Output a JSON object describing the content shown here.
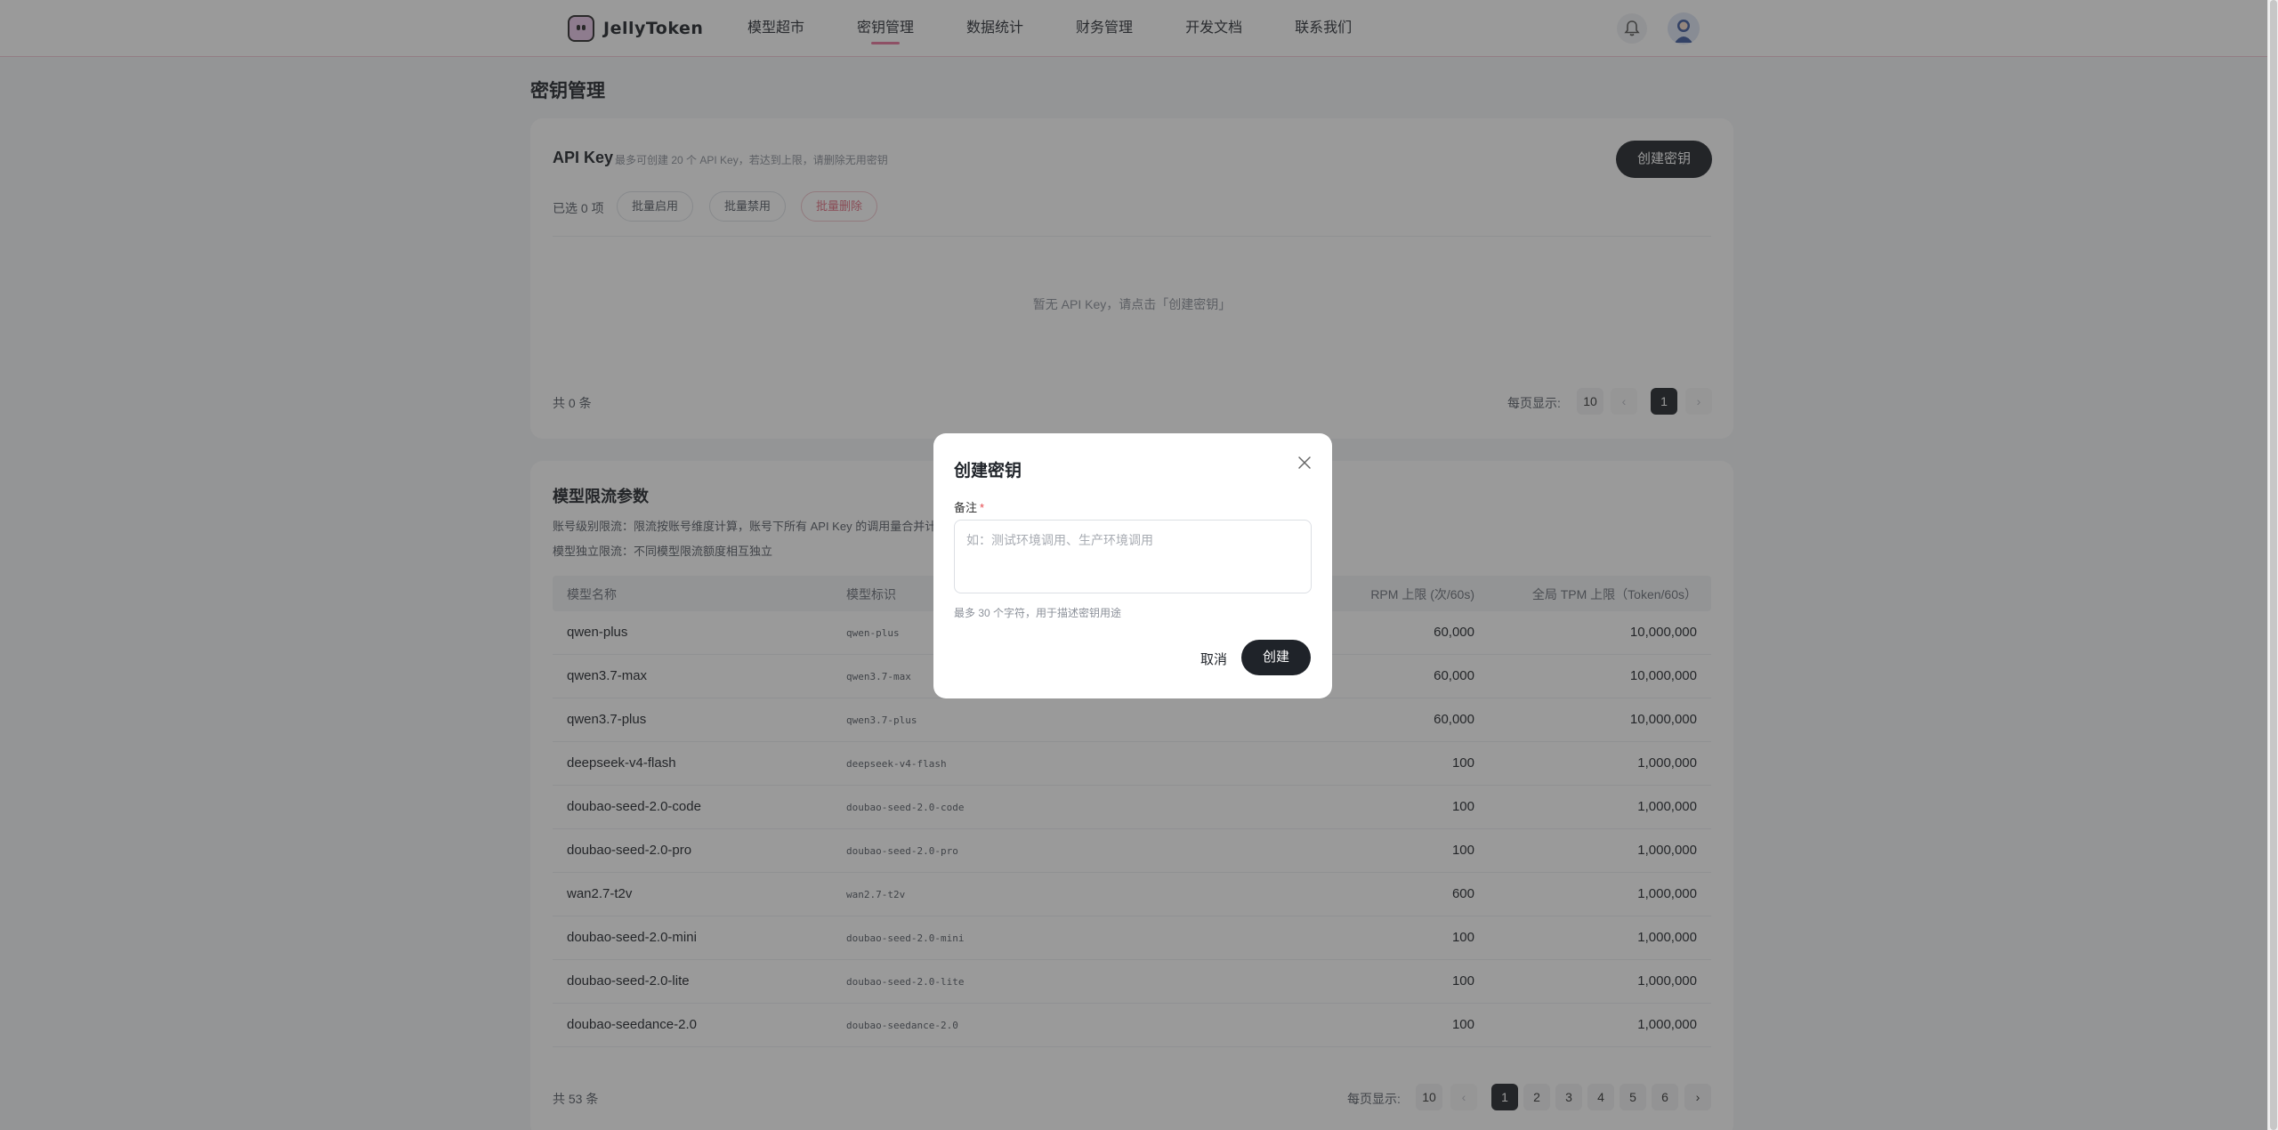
{
  "brand": {
    "name": "JellyToken"
  },
  "nav": [
    {
      "label": "模型超市"
    },
    {
      "label": "密钥管理",
      "active": true
    },
    {
      "label": "数据统计"
    },
    {
      "label": "财务管理"
    },
    {
      "label": "开发文档"
    },
    {
      "label": "联系我们"
    }
  ],
  "page": {
    "title": "密钥管理"
  },
  "api_key": {
    "title": "API Key",
    "subtitle": "最多可创建 20 个 API Key，若达到上限，请删除无用密钥",
    "create_label": "创建密钥",
    "selected": "已选 0 项",
    "batch_enable": "批量启用",
    "batch_disable": "批量禁用",
    "batch_delete": "批量删除",
    "empty": "暂无 API Key，请点击「创建密钥」",
    "total": "共 0 条",
    "per_page_label": "每页显示:",
    "per_page": "10",
    "prev": "‹",
    "next": "›",
    "current_page": "1"
  },
  "limits": {
    "title": "模型限流参数",
    "line1": "账号级别限流：限流按账号维度计算，账号下所有 API Key 的调用量合并计算",
    "line2": "模型独立限流：不同模型限流额度相互独立",
    "columns": [
      "模型名称",
      "模型标识",
      "RPM 上限 (次/60s)",
      "全局 TPM 上限（Token/60s）"
    ],
    "rows": [
      {
        "name": "qwen-plus",
        "id": "qwen-plus",
        "rpm": "60,000",
        "tpm": "10,000,000"
      },
      {
        "name": "qwen3.7-max",
        "id": "qwen3.7-max",
        "rpm": "60,000",
        "tpm": "10,000,000"
      },
      {
        "name": "qwen3.7-plus",
        "id": "qwen3.7-plus",
        "rpm": "60,000",
        "tpm": "10,000,000"
      },
      {
        "name": "deepseek-v4-flash",
        "id": "deepseek-v4-flash",
        "rpm": "100",
        "tpm": "1,000,000"
      },
      {
        "name": "doubao-seed-2.0-code",
        "id": "doubao-seed-2.0-code",
        "rpm": "100",
        "tpm": "1,000,000"
      },
      {
        "name": "doubao-seed-2.0-pro",
        "id": "doubao-seed-2.0-pro",
        "rpm": "100",
        "tpm": "1,000,000"
      },
      {
        "name": "wan2.7-t2v",
        "id": "wan2.7-t2v",
        "rpm": "600",
        "tpm": "1,000,000"
      },
      {
        "name": "doubao-seed-2.0-mini",
        "id": "doubao-seed-2.0-mini",
        "rpm": "100",
        "tpm": "1,000,000"
      },
      {
        "name": "doubao-seed-2.0-lite",
        "id": "doubao-seed-2.0-lite",
        "rpm": "100",
        "tpm": "1,000,000"
      },
      {
        "name": "doubao-seedance-2.0",
        "id": "doubao-seedance-2.0",
        "rpm": "100",
        "tpm": "1,000,000"
      }
    ],
    "total": "共 53 条",
    "per_page_label": "每页显示:",
    "per_page": "10",
    "prev": "‹",
    "next": "›",
    "pages": [
      "1",
      "2",
      "3",
      "4",
      "5",
      "6"
    ]
  },
  "modal": {
    "title": "创建密钥",
    "field_label": "备注",
    "required_mark": "*",
    "placeholder": "如：测试环境调用、生产环境调用",
    "value": "",
    "hint": "最多 30 个字符，用于描述密钥用途",
    "cancel_label": "取消",
    "create_label": "创建"
  },
  "icons": {
    "notification": "bell-icon",
    "user": "avatar-icon",
    "close": "close-icon"
  }
}
